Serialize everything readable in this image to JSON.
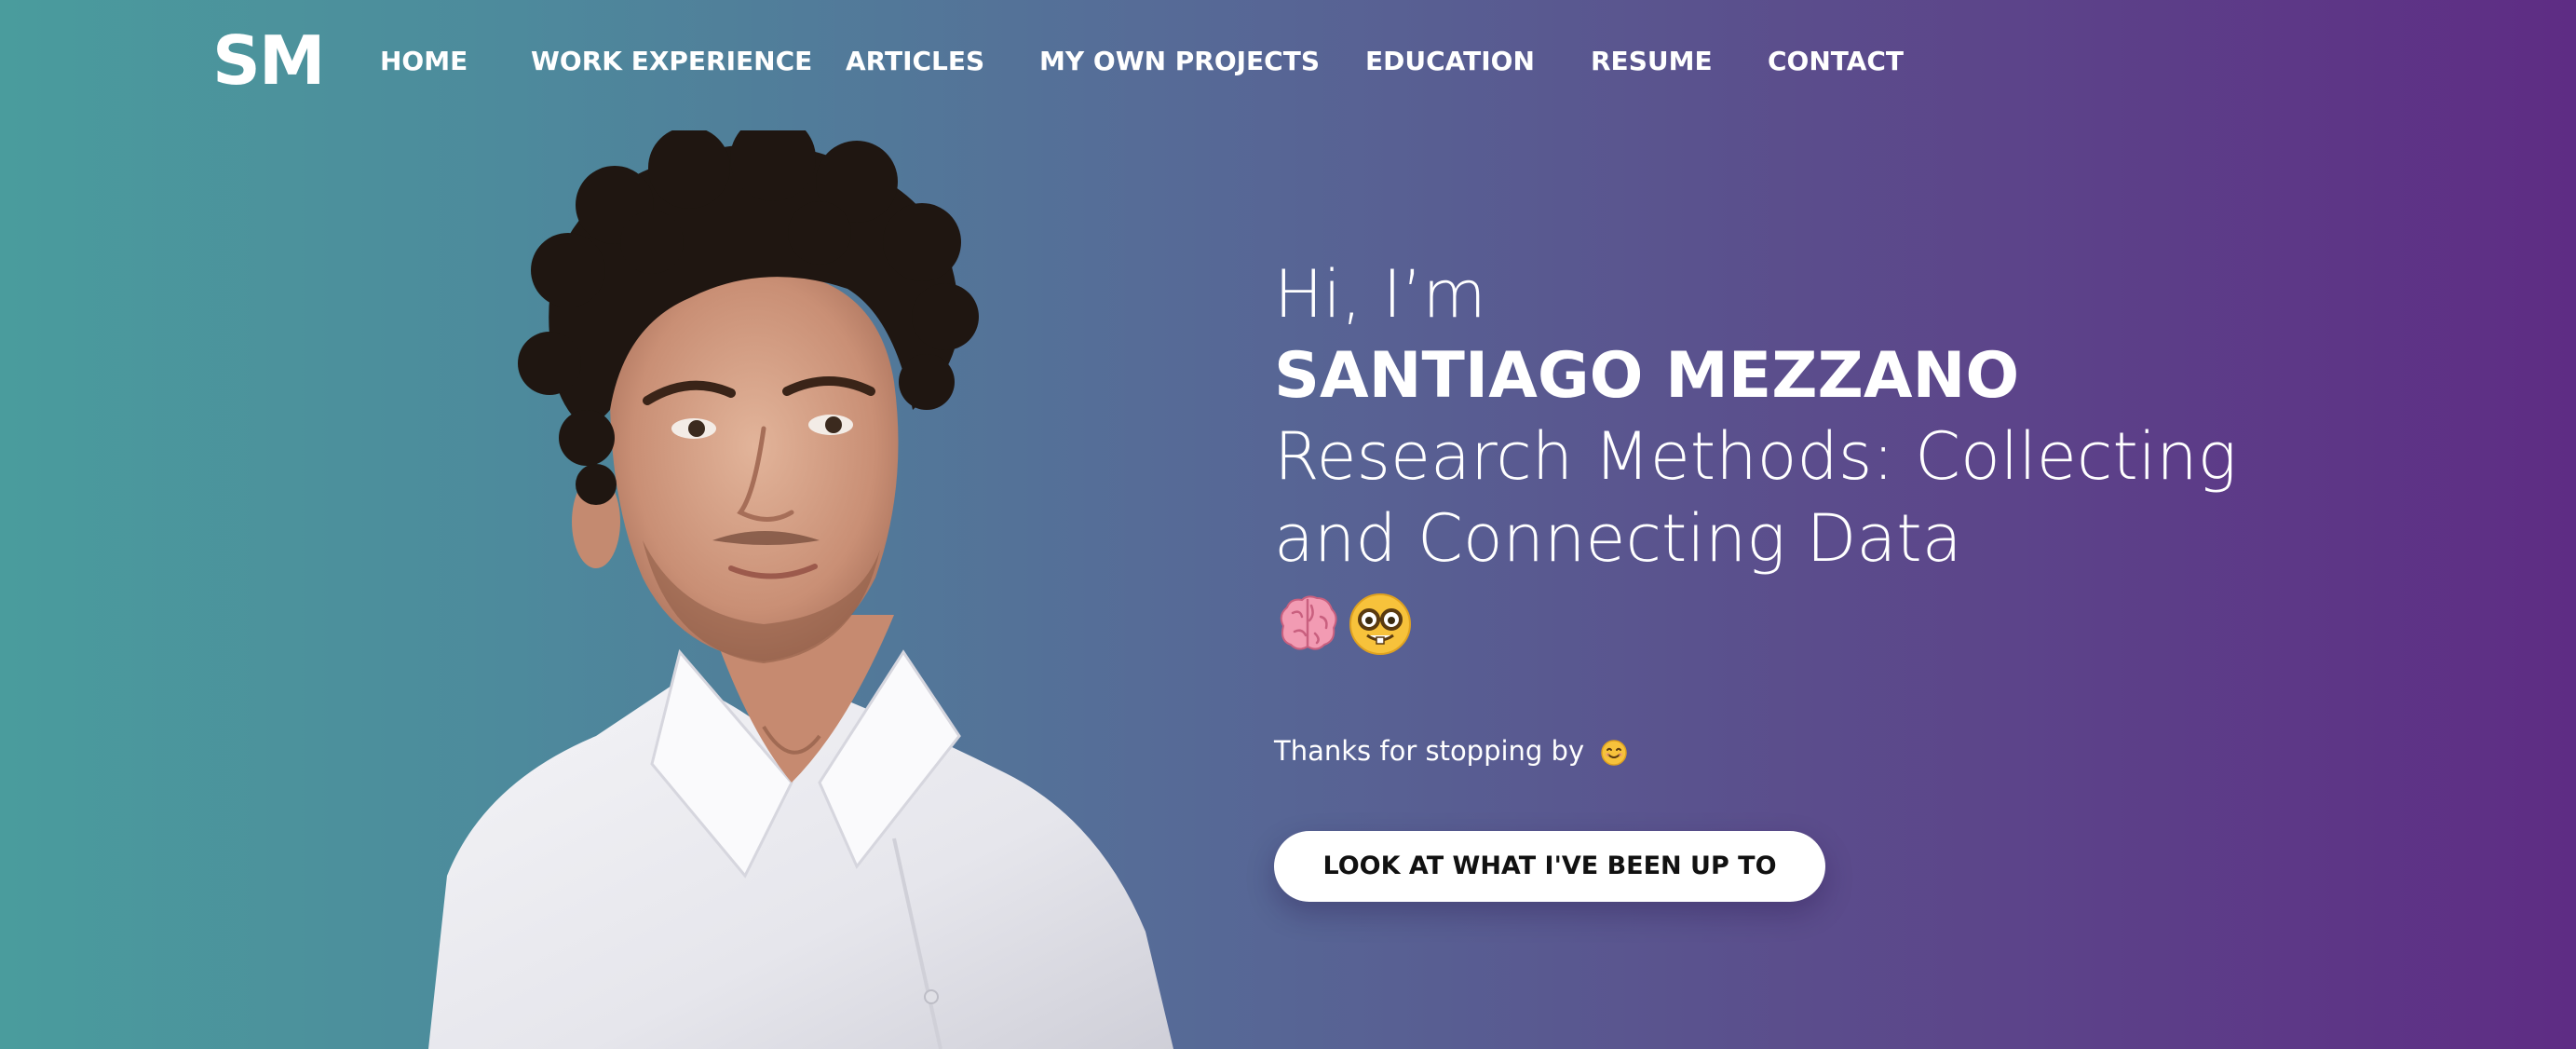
{
  "nav": {
    "logo": "SM",
    "items": [
      {
        "label": "HOME"
      },
      {
        "label": "WORK EXPERIENCE"
      },
      {
        "label": "ARTICLES"
      },
      {
        "label": "MY OWN PROJECTS"
      },
      {
        "label": "EDUCATION"
      },
      {
        "label": "RESUME"
      },
      {
        "label": "CONTACT"
      }
    ]
  },
  "hero": {
    "greeting": "Hi, I’m",
    "name": "SANTIAGO MEZZANO",
    "role": "Research Methods: Collecting and Connecting Data",
    "emojis": [
      "brain-icon",
      "nerd-face-icon"
    ],
    "thanks": "Thanks for stopping by",
    "thanks_emoji": "smiling-face-icon",
    "cta_label": "LOOK AT WHAT I'VE BEEN UP TO"
  },
  "colors": {
    "gradient_start": "#4a9c9d",
    "gradient_end": "#5e2c84",
    "button_bg": "#ffffff",
    "text": "#ffffff"
  }
}
